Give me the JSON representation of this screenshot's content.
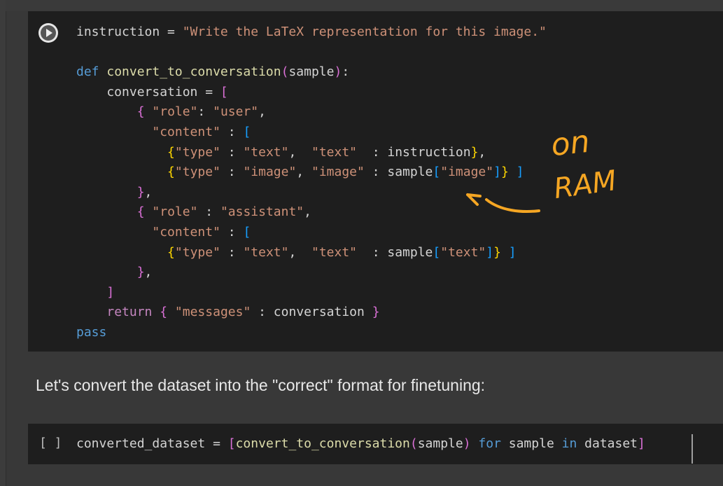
{
  "cell1": {
    "run_button": "run-cell",
    "lines": [
      "instruction = \"Write the LaTeX representation for this image.\"",
      "",
      "def convert_to_conversation(sample):",
      "    conversation = [",
      "        { \"role\": \"user\",",
      "          \"content\" : [",
      "            {\"type\" : \"text\",  \"text\"  : instruction},",
      "            {\"type\" : \"image\", \"image\" : sample[\"image\"]} ]",
      "        },",
      "        { \"role\" : \"assistant\",",
      "          \"content\" : [",
      "            {\"type\" : \"text\",  \"text\"  : sample[\"text\"]} ]",
      "        },",
      "    ]",
      "    return { \"messages\" : conversation }",
      "pass"
    ]
  },
  "annotation": {
    "line1": "on",
    "line2": "RAM",
    "color": "#f5a623"
  },
  "markdown": {
    "text": "Let's convert the dataset into the \"correct\" format for finetuning:"
  },
  "cell2": {
    "execution_count": "[ ]",
    "code": "converted_dataset = [convert_to_conversation(sample) for sample in dataset]"
  },
  "colors": {
    "background": "#383838",
    "cell_background": "#1e1e1e",
    "keyword": "#569cd6",
    "string": "#ce9178",
    "function": "#dcdcaa"
  }
}
